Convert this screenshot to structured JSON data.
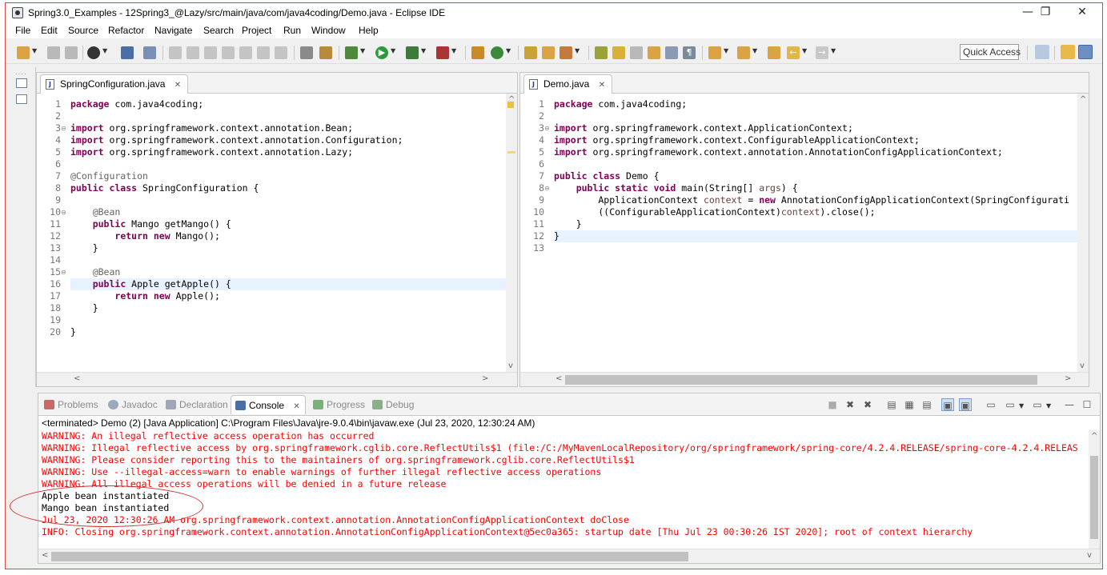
{
  "window": {
    "title": "Spring3.0_Examples - 12Spring3_@Lazy/src/main/java/com/java4coding/Demo.java - Eclipse IDE",
    "minimize": "—",
    "maximize": "❐",
    "close": "✕"
  },
  "menu": [
    "File",
    "Edit",
    "Source",
    "Refactor",
    "Navigate",
    "Search",
    "Project",
    "Run",
    "Window",
    "Help"
  ],
  "toolbar": {
    "quick_access": "Quick Access"
  },
  "editor_left": {
    "tab_label": "SpringConfiguration.java",
    "tab_close": "✕",
    "lines": [
      {
        "n": "1",
        "html": "<span class=\"kw\">package</span> com.java4coding;"
      },
      {
        "n": "2",
        "html": ""
      },
      {
        "n": "3",
        "html": "<span class=\"kw\">import</span> org.springframework.context.annotation.Bean;"
      },
      {
        "n": "4",
        "html": "<span class=\"kw\">import</span> org.springframework.context.annotation.Configuration;"
      },
      {
        "n": "5",
        "html": "<span class=\"kw\">import</span> org.springframework.context.annotation.Lazy;"
      },
      {
        "n": "6",
        "html": ""
      },
      {
        "n": "7",
        "html": "<span class=\"ann\">@Configuration</span>"
      },
      {
        "n": "8",
        "html": "<span class=\"kw\">public class</span> SpringConfiguration {"
      },
      {
        "n": "9",
        "html": ""
      },
      {
        "n": "10",
        "html": "    <span class=\"ann\">@Bean</span>"
      },
      {
        "n": "11",
        "html": "    <span class=\"kw\">public</span> Mango getMango() {"
      },
      {
        "n": "12",
        "html": "        <span class=\"kw\">return new</span> Mango();"
      },
      {
        "n": "13",
        "html": "    }"
      },
      {
        "n": "14",
        "html": ""
      },
      {
        "n": "15",
        "html": "    <span class=\"ann\">@Bean</span>"
      },
      {
        "n": "16",
        "html": "    <span class=\"kw\">public</span> Apple getApple() {"
      },
      {
        "n": "17",
        "html": "        <span class=\"kw\">return new</span> Apple();"
      },
      {
        "n": "18",
        "html": "    }"
      },
      {
        "n": "19",
        "html": ""
      },
      {
        "n": "20",
        "html": "}"
      }
    ]
  },
  "editor_right": {
    "tab_label": "Demo.java",
    "tab_close": "✕",
    "lines": [
      {
        "n": "1",
        "html": "<span class=\"kw\">package</span> com.java4coding;"
      },
      {
        "n": "2",
        "html": ""
      },
      {
        "n": "3",
        "html": "<span class=\"kw\">import</span> org.springframework.context.ApplicationContext;"
      },
      {
        "n": "4",
        "html": "<span class=\"kw\">import</span> org.springframework.context.ConfigurableApplicationContext;"
      },
      {
        "n": "5",
        "html": "<span class=\"kw\">import</span> org.springframework.context.annotation.AnnotationConfigApplicationContext;"
      },
      {
        "n": "6",
        "html": ""
      },
      {
        "n": "7",
        "html": "<span class=\"kw\">public class</span> Demo {"
      },
      {
        "n": "8",
        "html": "    <span class=\"kw\">public static void</span> main(String[] <span class=\"var\">args</span>) {"
      },
      {
        "n": "9",
        "html": "        ApplicationContext <span class=\"var\">context</span> = <span class=\"kw\">new</span> AnnotationConfigApplicationContext(SpringConfigurati"
      },
      {
        "n": "10",
        "html": "        ((ConfigurableApplicationContext)<span class=\"var\">context</span>).close();"
      },
      {
        "n": "11",
        "html": "    }"
      },
      {
        "n": "12",
        "html": "}"
      },
      {
        "n": "13",
        "html": ""
      }
    ]
  },
  "console": {
    "tabs": [
      "Problems",
      "Javadoc",
      "Declaration",
      "Console",
      "Progress",
      "Debug"
    ],
    "tab_close": "✕",
    "status": "<terminated> Demo (2) [Java Application] C:\\Program Files\\Java\\jre-9.0.4\\bin\\javaw.exe (Jul 23, 2020, 12:30:24 AM)",
    "output": [
      {
        "type": "err",
        "text": "WARNING: An illegal reflective access operation has occurred"
      },
      {
        "type": "err",
        "text": "WARNING: Illegal reflective access by org.springframework.cglib.core.ReflectUtils$1 (file:/C:/MyMavenLocalRepository/org/springframework/spring-core/4.2.4.RELEASE/spring-core-4.2.4.RELEAS"
      },
      {
        "type": "err",
        "text": "WARNING: Please consider reporting this to the maintainers of org.springframework.cglib.core.ReflectUtils$1"
      },
      {
        "type": "err",
        "text": "WARNING: Use --illegal-access=warn to enable warnings of further illegal reflective access operations"
      },
      {
        "type": "err",
        "text": "WARNING: All illegal access operations will be denied in a future release"
      },
      {
        "type": "out",
        "text": "Apple bean instantiated"
      },
      {
        "type": "out",
        "text": "Mango bean instantiated"
      },
      {
        "type": "err",
        "text": "Jul 23, 2020 12:30:26 AM org.springframework.context.annotation.AnnotationConfigApplicationContext doClose"
      },
      {
        "type": "err",
        "text": "INFO: Closing org.springframework.context.annotation.AnnotationConfigApplicationContext@5ec0a365: startup date [Thu Jul 23 00:30:26 IST 2020]; root of context hierarchy"
      }
    ]
  }
}
